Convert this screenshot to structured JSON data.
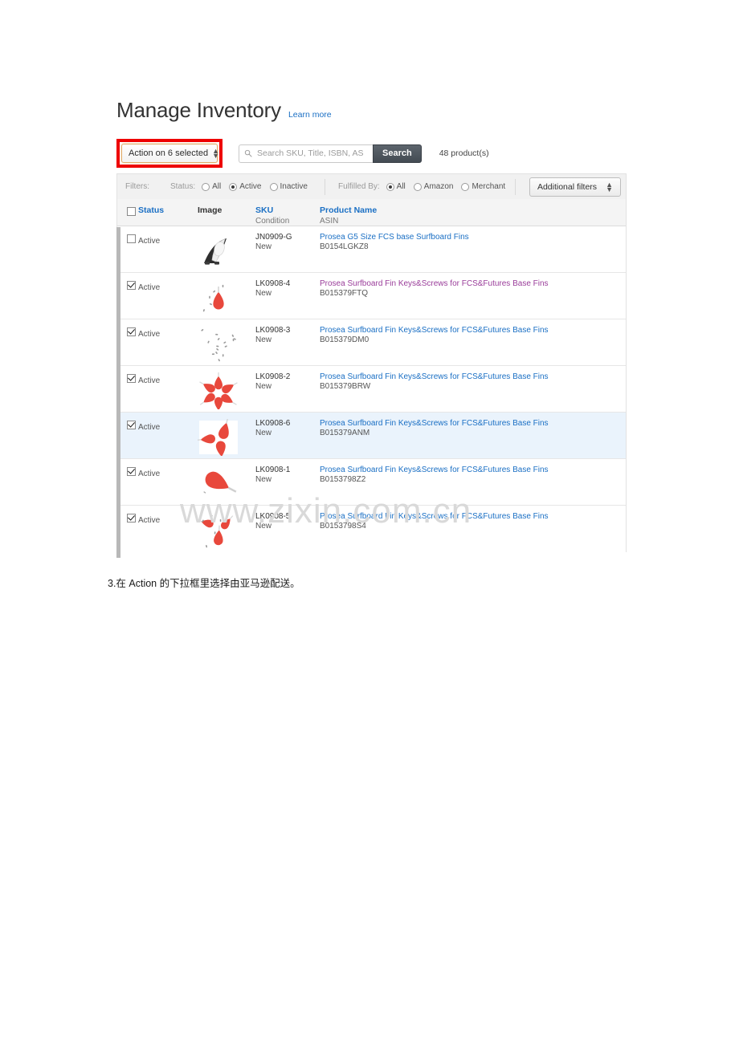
{
  "header": {
    "title": "Manage Inventory",
    "learn_more": "Learn more"
  },
  "toolbar": {
    "action_select_label": "Action on 6 selected",
    "search_placeholder": "Search SKU, Title, ISBN, AS",
    "search_value": "",
    "search_button": "Search",
    "product_count": "48 product(s)",
    "search_icon": "search-icon"
  },
  "filters": {
    "label": "Filters:",
    "status": {
      "label": "Status:",
      "options": [
        "All",
        "Active",
        "Inactive"
      ],
      "selected": "Active"
    },
    "fulfilled_by": {
      "label": "Fulfilled By:",
      "options": [
        "All",
        "Amazon",
        "Merchant"
      ],
      "selected": "All"
    },
    "additional_filters_label": "Additional filters"
  },
  "table": {
    "columns": {
      "status": "Status",
      "image": "Image",
      "sku": "SKU",
      "sku_sub": "Condition",
      "product_name": "Product Name",
      "product_name_sub": "ASIN"
    },
    "header_checkbox_checked": false,
    "rows": [
      {
        "checked": false,
        "highlight": false,
        "status": "Active",
        "sku": "JN0909-G",
        "condition": "New",
        "product_name": "Prosea G5 Size FCS base Surfboard Fins",
        "asin": "B0154LGKZ8",
        "name_visited": false,
        "thumb": "fin-black-white"
      },
      {
        "checked": true,
        "highlight": false,
        "status": "Active",
        "sku": "LK0908-4",
        "condition": "New",
        "product_name": "Prosea Surfboard Fin Keys&Screws for FCS&Futures Base Fins",
        "asin": "B015379FTQ",
        "name_visited": true,
        "thumb": "fin-key-single"
      },
      {
        "checked": true,
        "highlight": false,
        "status": "Active",
        "sku": "LK0908-3",
        "condition": "New",
        "product_name": "Prosea Surfboard Fin Keys&Screws for FCS&Futures Base Fins",
        "asin": "B015379DM0",
        "name_visited": false,
        "thumb": "screws-scatter"
      },
      {
        "checked": true,
        "highlight": false,
        "status": "Active",
        "sku": "LK0908-2",
        "condition": "New",
        "product_name": "Prosea Surfboard Fin Keys&Screws for FCS&Futures Base Fins",
        "asin": "B015379BRW",
        "name_visited": false,
        "thumb": "fin-key-flower"
      },
      {
        "checked": true,
        "highlight": true,
        "status": "Active",
        "sku": "LK0908-6",
        "condition": "New",
        "product_name": "Prosea Surfboard Fin Keys&Screws for FCS&Futures Base Fins",
        "asin": "B015379ANM",
        "name_visited": false,
        "thumb": "fin-key-triple"
      },
      {
        "checked": true,
        "highlight": false,
        "status": "Active",
        "sku": "LK0908-1",
        "condition": "New",
        "product_name": "Prosea Surfboard Fin Keys&Screws for FCS&Futures Base Fins",
        "asin": "B0153798Z2",
        "name_visited": false,
        "thumb": "fin-key-big"
      },
      {
        "checked": true,
        "highlight": false,
        "status": "Active",
        "sku": "LK0908-5",
        "condition": "New",
        "product_name": "Prosea Surfboard Fin Keys&Screws for FCS&Futures Base Fins",
        "asin": "B0153798S4",
        "name_visited": false,
        "thumb": "fin-key-pair"
      }
    ]
  },
  "watermark": "www.zixin.com.cn",
  "caption": "3.在 Action 的下拉框里选择由亚马逊配送。",
  "colors": {
    "link": "#1a6fc4",
    "visited_link": "#9a3d9a",
    "highlight_row": "#eaf3fc",
    "red_callout": "#ee0000",
    "focus_border": "#e0ac6a",
    "search_button": "#434b53",
    "thumb_red": "#e8483c"
  }
}
